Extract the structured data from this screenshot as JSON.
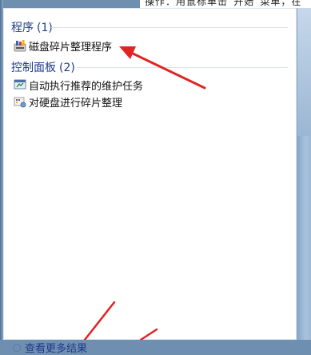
{
  "background_strip": {
    "text": "操作：用鼠标单击“开始”菜单，在搜索栏中输入"
  },
  "groups": [
    {
      "title": "程序",
      "count": "(1)",
      "items": [
        {
          "label": "磁盘碎片整理程序",
          "icon": "defrag-program-icon"
        }
      ]
    },
    {
      "title": "控制面板",
      "count": "(2)",
      "items": [
        {
          "label": "自动执行推荐的维护任务",
          "icon": "maintenance-icon"
        },
        {
          "label": "对硬盘进行碎片整理",
          "icon": "defrag-task-icon"
        }
      ]
    }
  ],
  "see_more": {
    "label": "查看更多结果",
    "icon": "search-icon"
  },
  "colors": {
    "header_text": "#1e3c8c",
    "arrow": "#e02424",
    "backdrop": "#6f8fb0"
  }
}
